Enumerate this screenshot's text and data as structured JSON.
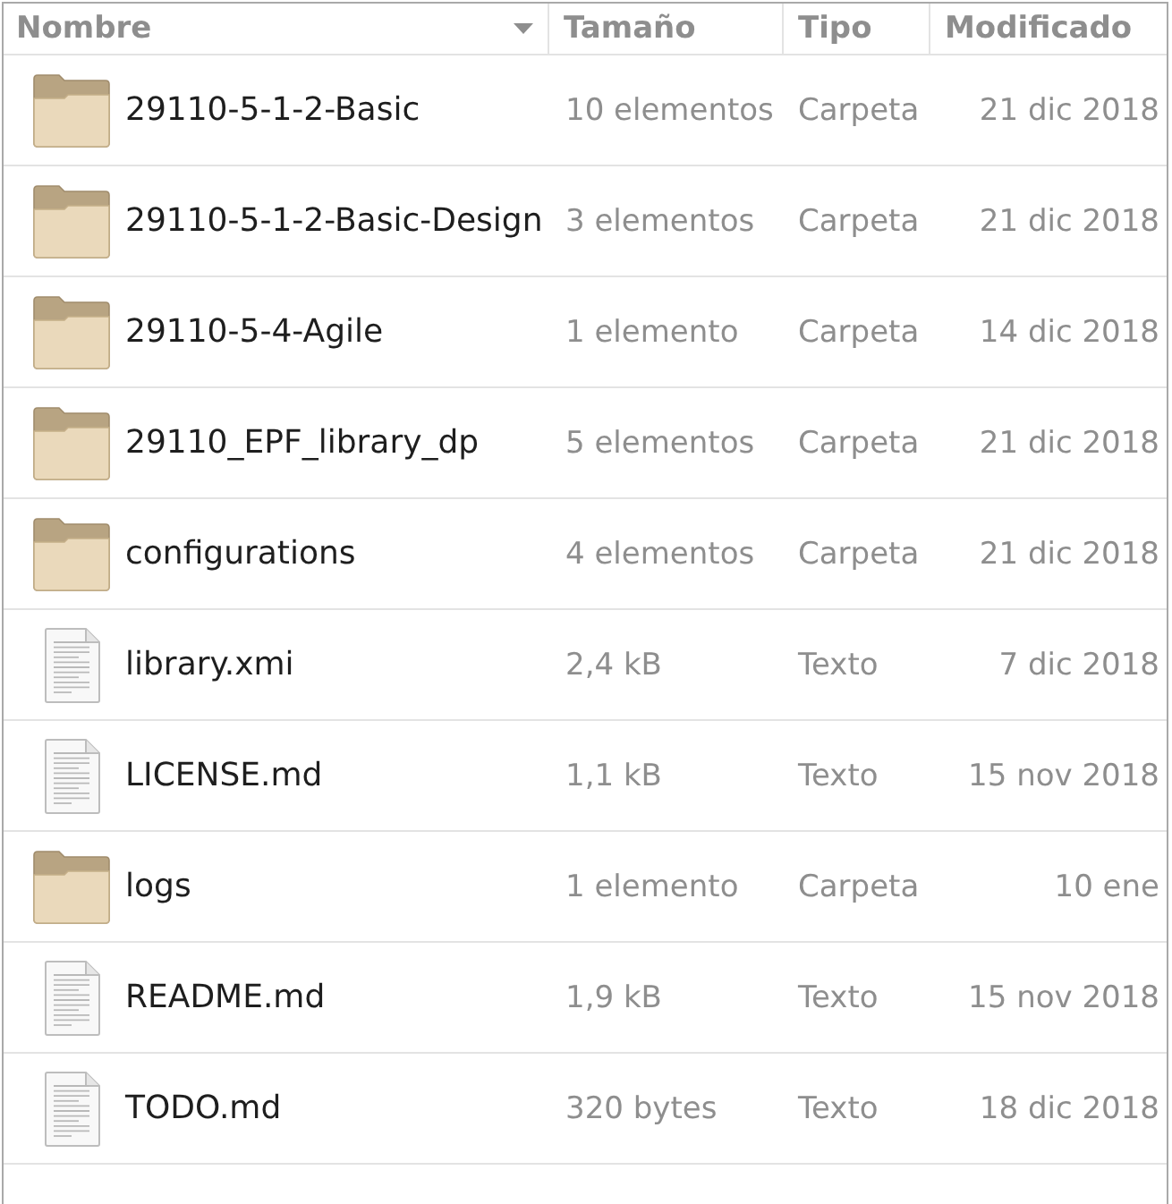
{
  "columns": [
    {
      "label": "Nombre",
      "sorted": true
    },
    {
      "label": "Tamaño",
      "sorted": false
    },
    {
      "label": "Tipo",
      "sorted": false
    },
    {
      "label": "Modificado",
      "sorted": false
    }
  ],
  "rows": [
    {
      "kind": "folder",
      "name": "29110-5-1-2-Basic",
      "size": "10 elementos",
      "type": "Carpeta",
      "modified": "21 dic 2018"
    },
    {
      "kind": "folder",
      "name": "29110-5-1-2-Basic-Design",
      "size": "3 elementos",
      "type": "Carpeta",
      "modified": "21 dic 2018"
    },
    {
      "kind": "folder",
      "name": "29110-5-4-Agile",
      "size": "1 elemento",
      "type": "Carpeta",
      "modified": "14 dic 2018"
    },
    {
      "kind": "folder",
      "name": "29110_EPF_library_dp",
      "size": "5 elementos",
      "type": "Carpeta",
      "modified": "21 dic 2018"
    },
    {
      "kind": "folder",
      "name": "configurations",
      "size": "4 elementos",
      "type": "Carpeta",
      "modified": "21 dic 2018"
    },
    {
      "kind": "file",
      "name": "library.xmi",
      "size": "2,4 kB",
      "type": "Texto",
      "modified": "7 dic 2018"
    },
    {
      "kind": "file",
      "name": "LICENSE.md",
      "size": "1,1 kB",
      "type": "Texto",
      "modified": "15 nov 2018"
    },
    {
      "kind": "folder",
      "name": "logs",
      "size": "1 elemento",
      "type": "Carpeta",
      "modified": "10 ene"
    },
    {
      "kind": "file",
      "name": "README.md",
      "size": "1,9 kB",
      "type": "Texto",
      "modified": "15 nov 2018"
    },
    {
      "kind": "file",
      "name": "TODO.md",
      "size": "320 bytes",
      "type": "Texto",
      "modified": "18 dic 2018"
    }
  ]
}
